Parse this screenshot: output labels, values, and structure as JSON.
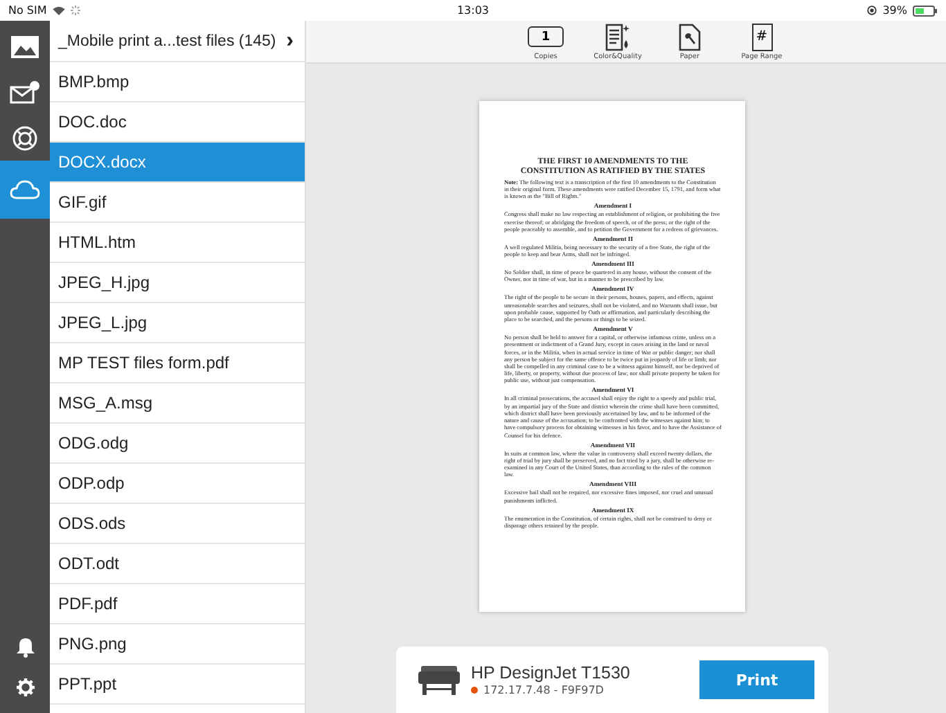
{
  "status_bar": {
    "carrier": "No SIM",
    "time": "13:03",
    "battery": "39%"
  },
  "rail": {
    "items": [
      {
        "kind": "photos",
        "selected": false
      },
      {
        "kind": "email",
        "selected": false
      },
      {
        "kind": "support",
        "selected": false
      },
      {
        "kind": "cloud",
        "selected": true
      }
    ],
    "bottom_items": [
      {
        "kind": "notifications"
      },
      {
        "kind": "settings"
      }
    ]
  },
  "file_list": {
    "folder": "_Mobile print a...test files (145)",
    "chevron": "›",
    "items": [
      {
        "name": "BMP.bmp",
        "selected": false
      },
      {
        "name": "DOC.doc",
        "selected": false
      },
      {
        "name": "DOCX.docx",
        "selected": true
      },
      {
        "name": "GIF.gif",
        "selected": false
      },
      {
        "name": "HTML.htm",
        "selected": false
      },
      {
        "name": "JPEG_H.jpg",
        "selected": false
      },
      {
        "name": "JPEG_L.jpg",
        "selected": false
      },
      {
        "name": "MP TEST files form.pdf",
        "selected": false
      },
      {
        "name": "MSG_A.msg",
        "selected": false
      },
      {
        "name": "ODG.odg",
        "selected": false
      },
      {
        "name": "ODP.odp",
        "selected": false
      },
      {
        "name": "ODS.ods",
        "selected": false
      },
      {
        "name": "ODT.odt",
        "selected": false
      },
      {
        "name": "PDF.pdf",
        "selected": false
      },
      {
        "name": "PNG.png",
        "selected": false
      },
      {
        "name": "PPT.ppt",
        "selected": false
      }
    ]
  },
  "toolbar": [
    {
      "kind": "copies",
      "label": "Copies",
      "value": "1"
    },
    {
      "kind": "quality",
      "label": "Color&Quality"
    },
    {
      "kind": "paper",
      "label": "Paper"
    },
    {
      "kind": "range",
      "label": "Page Range",
      "value": "#"
    }
  ],
  "document": {
    "title_lines": [
      "THE FIRST 10 AMENDMENTS TO THE",
      "CONSTITUTION AS RATIFIED BY THE STATES"
    ],
    "note": "**Note:** The following text is a transcription of the first 10 amendments to the Constitution in their original form. These amendments were ratified December 15, 1791, and form what is known as the \"Bill of Rights.\"",
    "sections": [
      {
        "heading": "Amendment I",
        "text": "Congress shall make no law respecting an establishment of religion, or prohibiting the free exercise thereof; or abridging the freedom of speech, or of the press; or the right of the people peaceably to assemble, and to petition the Government for a redress of grievances."
      },
      {
        "heading": "Amendment II",
        "text": "A well regulated Militia, being necessary to the security of a free State, the right of the people to keep and bear Arms, shall not be infringed."
      },
      {
        "heading": "Amendment III",
        "text": "No Soldier shall, in time of peace be quartered in any house, without the consent of the Owner, nor in time of war, but in a manner to be prescribed by law."
      },
      {
        "heading": "Amendment IV",
        "text": "The right of the people to be secure in their persons, houses, papers, and effects, against unreasonable searches and seizures, shall not be violated, and no Warrants shall issue, but upon probable cause, supported by Oath or affirmation, and particularly describing the place to be searched, and the persons or things to be seized."
      },
      {
        "heading": "Amendment V",
        "text": "No person shall be held to answer for a capital, or otherwise infamous crime, unless on a presentment or indictment of a Grand Jury, except in cases arising in the land or naval forces, or in the Militia, when in actual service in time of War or public danger; nor shall any person be subject for the same offence to be twice put in jeopardy of life or limb; nor shall be compelled in any criminal case to be a witness against himself, nor be deprived of life, liberty, or property, without due process of law; nor shall private property be taken for public use, without just compensation."
      },
      {
        "heading": "Amendment VI",
        "text": "In all criminal prosecutions, the accused shall enjoy the right to a speedy and public trial, by an impartial jury of the State and district wherein the crime shall have been committed, which district shall have been previously ascertained by law, and to be informed of the nature and cause of the accusation; to be confronted with the witnesses against him; to have compulsory process for obtaining witnesses in his favor, and to have the Assistance of Counsel for his defence."
      },
      {
        "heading": "Amendment VII",
        "text": "In suits at common law, where the value in controversy shall exceed twenty dollars, the right of trial by jury shall be preserved, and no fact tried by a jury, shall be otherwise re-examined in any Court of the United States, than according to the rules of the common law."
      },
      {
        "heading": "Amendment VIII",
        "text": "Excessive bail shall not be required, nor excessive fines imposed, nor cruel and unusual punishments inflicted."
      },
      {
        "heading": "Amendment IX",
        "text": "The enumeration in the Constitution, of certain rights, shall not be construed to deny or disparage others retained by the people."
      }
    ]
  },
  "printer": {
    "name": "HP DesignJet T1530",
    "address": "172.17.7.48 - F9F97D",
    "color": "#e8540f",
    "print_button": "Print"
  }
}
